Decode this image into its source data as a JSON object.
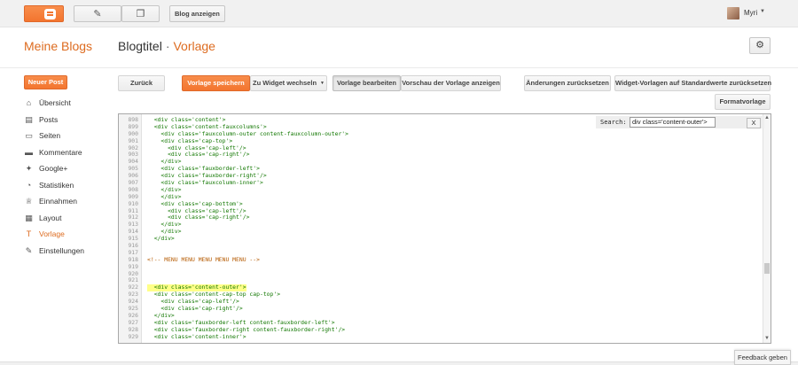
{
  "topbar": {
    "blogger_icon": "blogger-logo-icon",
    "compose_icon": "pencil-icon",
    "pages_icon": "copy-icon",
    "view_blog_label": "Blog anzeigen",
    "user_name": "Myri"
  },
  "header": {
    "brand": "Meine Blogs",
    "blog_title": "Blogtitel",
    "separator": "·",
    "section": "Vorlage",
    "settings_icon": "gear-icon"
  },
  "sidebar": {
    "new_post_label": "Neuer Post",
    "items": [
      {
        "label": "Übersicht",
        "icon": "home-icon",
        "glyph": "⌂"
      },
      {
        "label": "Posts",
        "icon": "posts-icon",
        "glyph": "▤"
      },
      {
        "label": "Seiten",
        "icon": "pages-icon",
        "glyph": "▭"
      },
      {
        "label": "Kommentare",
        "icon": "comment-icon",
        "glyph": "▬"
      },
      {
        "label": "Google+",
        "icon": "google-plus-icon",
        "glyph": "✦"
      },
      {
        "label": "Statistiken",
        "icon": "stats-icon",
        "glyph": "◔"
      },
      {
        "label": "Einnahmen",
        "icon": "trophy-icon",
        "glyph": "♕"
      },
      {
        "label": "Layout",
        "icon": "layout-icon",
        "glyph": "▦"
      },
      {
        "label": "Vorlage",
        "icon": "template-icon",
        "glyph": "T",
        "active": true
      },
      {
        "label": "Einstellungen",
        "icon": "wrench-icon",
        "glyph": "✎"
      }
    ]
  },
  "toolbar": {
    "back": "Zurück",
    "save": "Vorlage speichern",
    "jump_widget": "Zu Widget wechseln",
    "edit": "Vorlage bearbeiten",
    "preview": "Vorschau der Vorlage anzeigen",
    "revert": "Änderungen zurücksetzen",
    "reset_widgets": "Widget-Vorlagen auf Standardwerte zurücksetzen",
    "format": "Formatvorlage"
  },
  "editor": {
    "search_label": "Search:",
    "search_value": "div class='content-outer'>",
    "search_close": "X",
    "lines": [
      {
        "n": "898",
        "t": "  <div class='content'>"
      },
      {
        "n": "899",
        "t": "  <div class='content-fauxcolumns'>"
      },
      {
        "n": "900",
        "t": "    <div class='fauxcolumn-outer content-fauxcolumn-outer'>"
      },
      {
        "n": "901",
        "t": "    <div class='cap-top'>"
      },
      {
        "n": "902",
        "t": "      <div class='cap-left'/>"
      },
      {
        "n": "903",
        "t": "      <div class='cap-right'/>"
      },
      {
        "n": "904",
        "t": "    </div>"
      },
      {
        "n": "905",
        "t": "    <div class='fauxborder-left'>"
      },
      {
        "n": "906",
        "t": "    <div class='fauxborder-right'/>"
      },
      {
        "n": "907",
        "t": "    <div class='fauxcolumn-inner'>"
      },
      {
        "n": "908",
        "t": "    </div>"
      },
      {
        "n": "909",
        "t": "    </div>"
      },
      {
        "n": "910",
        "t": "    <div class='cap-bottom'>"
      },
      {
        "n": "911",
        "t": "      <div class='cap-left'/>"
      },
      {
        "n": "912",
        "t": "      <div class='cap-right'/>"
      },
      {
        "n": "913",
        "t": "    </div>"
      },
      {
        "n": "914",
        "t": "    </div>"
      },
      {
        "n": "915",
        "t": "  </div>"
      },
      {
        "n": "916",
        "t": ""
      },
      {
        "n": "917",
        "t": ""
      },
      {
        "n": "918",
        "t": "<!-- MENU MENU MENU MENU MENU -->",
        "type": "comment"
      },
      {
        "n": "919",
        "t": ""
      },
      {
        "n": "920",
        "t": ""
      },
      {
        "n": "921",
        "t": ""
      },
      {
        "n": "922",
        "t": "  <div class='content-outer'>",
        "type": "highlight"
      },
      {
        "n": "923",
        "t": "  <div class='content-cap-top cap-top'>"
      },
      {
        "n": "924",
        "t": "    <div class='cap-left'/>"
      },
      {
        "n": "925",
        "t": "    <div class='cap-right'/>"
      },
      {
        "n": "926",
        "t": "  </div>"
      },
      {
        "n": "927",
        "t": "  <div class='fauxborder-left content-fauxborder-left'>"
      },
      {
        "n": "928",
        "t": "  <div class='fauxborder-right content-fauxborder-right'/>"
      },
      {
        "n": "929",
        "t": "  <div class='content-inner'>"
      }
    ]
  },
  "feedback_label": "Feedback geben",
  "colors": {
    "accent": "#f3752f",
    "brand_text": "#dd6b1f",
    "code_tag": "#117700",
    "code_string": "#aa1111",
    "code_comment": "#b55a00",
    "highlight": "#ffff88"
  }
}
